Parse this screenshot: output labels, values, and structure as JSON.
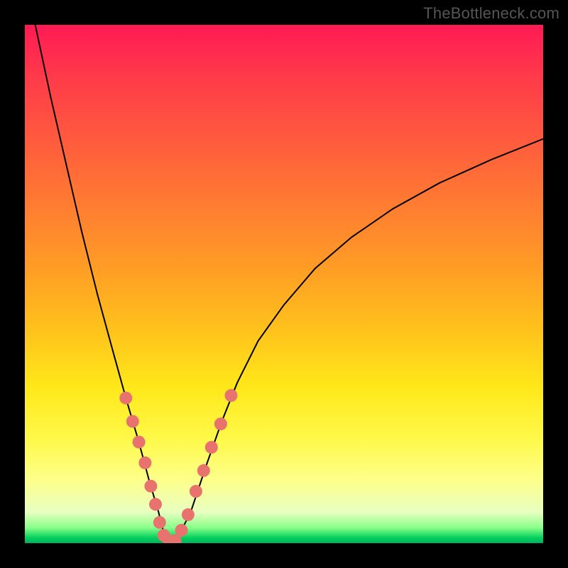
{
  "watermark": "TheBottleneck.com",
  "chart_data": {
    "type": "line",
    "title": "",
    "xlabel": "",
    "ylabel": "",
    "x_range": [
      0,
      1
    ],
    "y_range": [
      0,
      1
    ],
    "grid": false,
    "legend": false,
    "watermark_text": "TheBottleneck.com",
    "background_gradient_stops": [
      {
        "pos": 0.0,
        "color": "#ff1a54"
      },
      {
        "pos": 0.1,
        "color": "#ff3a4a"
      },
      {
        "pos": 0.22,
        "color": "#ff5a3e"
      },
      {
        "pos": 0.34,
        "color": "#ff7a32"
      },
      {
        "pos": 0.46,
        "color": "#ff9a26"
      },
      {
        "pos": 0.58,
        "color": "#ffbf1c"
      },
      {
        "pos": 0.7,
        "color": "#ffe81a"
      },
      {
        "pos": 0.8,
        "color": "#fff94a"
      },
      {
        "pos": 0.88,
        "color": "#fdff8c"
      },
      {
        "pos": 0.94,
        "color": "#e8ffc0"
      },
      {
        "pos": 0.97,
        "color": "#8aff8a"
      },
      {
        "pos": 0.99,
        "color": "#00d05c"
      },
      {
        "pos": 1.0,
        "color": "#00b060"
      }
    ],
    "series": [
      {
        "name": "bottleneck-curve",
        "color": "#000000",
        "stroke_width": 2,
        "x": [
          0.02,
          0.05,
          0.08,
          0.11,
          0.14,
          0.17,
          0.195,
          0.22,
          0.24,
          0.258,
          0.268,
          0.278,
          0.292,
          0.32,
          0.35,
          0.38,
          0.41,
          0.45,
          0.5,
          0.56,
          0.63,
          0.71,
          0.8,
          0.9,
          1.0
        ],
        "y": [
          1.0,
          0.86,
          0.73,
          0.6,
          0.48,
          0.37,
          0.28,
          0.195,
          0.12,
          0.06,
          0.02,
          0.005,
          0.005,
          0.06,
          0.15,
          0.235,
          0.31,
          0.39,
          0.46,
          0.53,
          0.59,
          0.645,
          0.695,
          0.74,
          0.78
        ]
      }
    ],
    "markers": {
      "name": "highlight-dots",
      "shape": "circle",
      "color": "#e8736e",
      "radius": 9,
      "points": [
        {
          "x": 0.195,
          "y": 0.28
        },
        {
          "x": 0.208,
          "y": 0.235
        },
        {
          "x": 0.22,
          "y": 0.195
        },
        {
          "x": 0.232,
          "y": 0.155
        },
        {
          "x": 0.243,
          "y": 0.11
        },
        {
          "x": 0.252,
          "y": 0.075
        },
        {
          "x": 0.26,
          "y": 0.04
        },
        {
          "x": 0.268,
          "y": 0.015
        },
        {
          "x": 0.278,
          "y": 0.005
        },
        {
          "x": 0.29,
          "y": 0.005
        },
        {
          "x": 0.302,
          "y": 0.025
        },
        {
          "x": 0.315,
          "y": 0.055
        },
        {
          "x": 0.33,
          "y": 0.1
        },
        {
          "x": 0.345,
          "y": 0.14
        },
        {
          "x": 0.36,
          "y": 0.185
        },
        {
          "x": 0.378,
          "y": 0.23
        },
        {
          "x": 0.398,
          "y": 0.285
        }
      ]
    }
  }
}
